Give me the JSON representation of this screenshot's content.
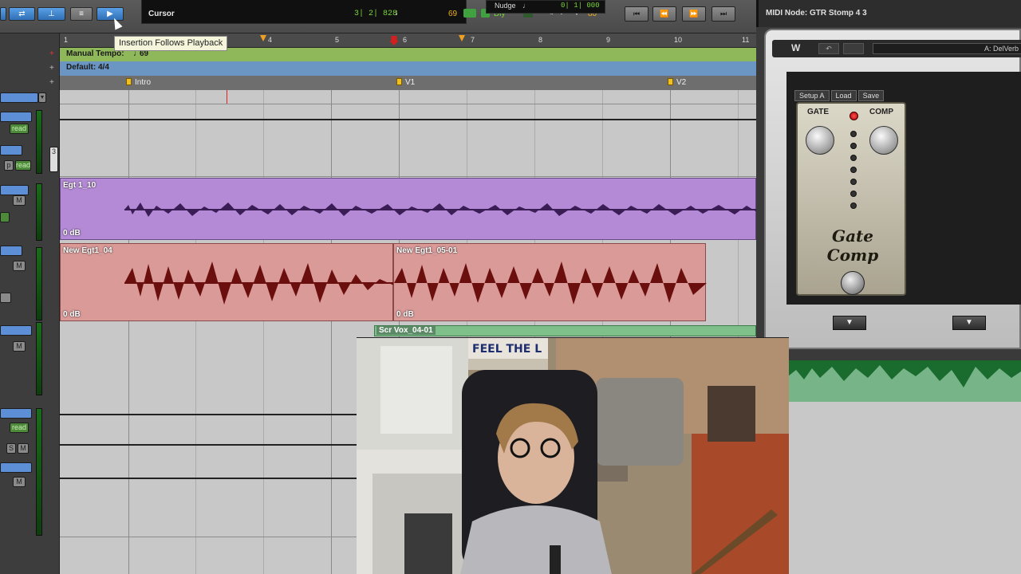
{
  "toolbar": {
    "counter_label": "Cursor",
    "counter_value": "3| 2| 828",
    "note_symbol": "♩",
    "tempo_value": "69",
    "dly_label": "Dly",
    "count_value": "80",
    "nudge_label": "Nudge",
    "nudge_note": "♩",
    "nudge_value": "0| 1| 000"
  },
  "tooltip": "Insertion Follows Playback",
  "rulers": {
    "bars": [
      "1",
      "2",
      "3",
      "4",
      "5",
      "6",
      "7",
      "8",
      "9",
      "10",
      "11"
    ],
    "tempo_label": "Manual Tempo:",
    "tempo_note": "♩",
    "tempo_value": "69",
    "meter_label": "Default: 4/4",
    "markers": [
      {
        "label": "Intro"
      },
      {
        "label": "V1"
      },
      {
        "label": "V2"
      }
    ]
  },
  "clips": [
    {
      "name": "Egt 1_10",
      "gain": "0 dB",
      "color": "#b48ad6"
    },
    {
      "name": "New Egt1_04",
      "gain": "0 dB",
      "color": "#d99a98"
    },
    {
      "name": "New Egt1_05-01",
      "gain": "0 dB",
      "color": "#d99a98"
    },
    {
      "name": "Scr Vox_04-01",
      "gain": "",
      "color": "#7fbf8a"
    }
  ],
  "left_buttons": {
    "read": "read",
    "m": "M",
    "s": "S",
    "p": "p",
    "counter_value": "3"
  },
  "plugin": {
    "title": "MIDI Node: GTR Stomp 4 3",
    "preset": "A: DelVerb",
    "setup": "Setup A",
    "load": "Load",
    "save": "Save",
    "gate_label": "GATE",
    "comp_label": "COMP",
    "pedal_name": "Gate Comp"
  },
  "webcam": {
    "poster_text": "FEEL THE L"
  },
  "icons": {
    "play": "▶",
    "rewind": "⏮",
    "back": "⏪",
    "forward": "⏩",
    "end": "⏭",
    "undo": "↶",
    "down": "▼"
  }
}
